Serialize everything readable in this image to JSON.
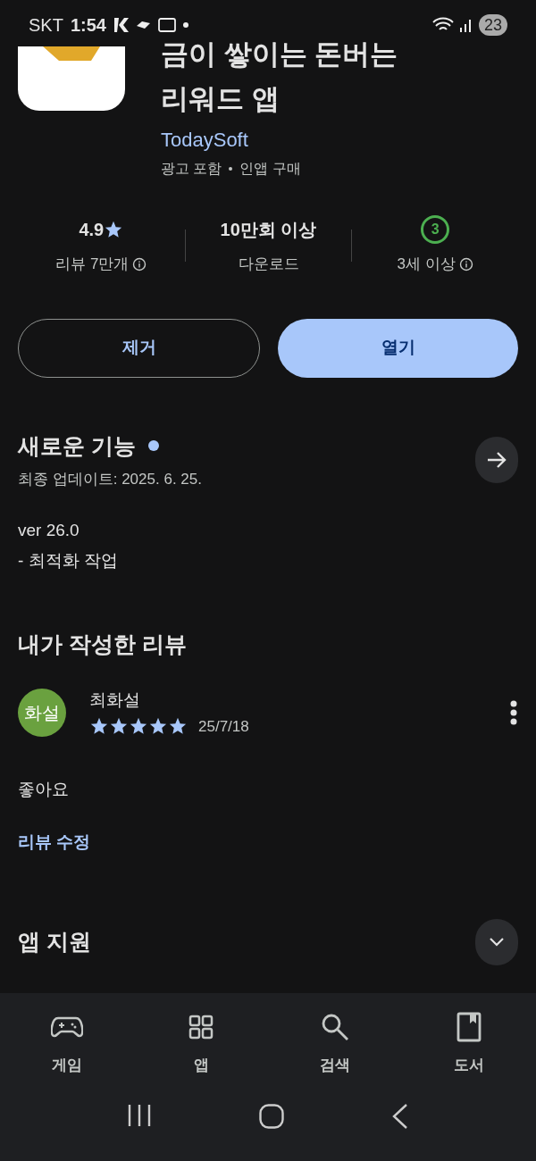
{
  "status_bar": {
    "carrier": "SKT",
    "time": "1:54",
    "notification_count": "23"
  },
  "app": {
    "title_lines": [
      "금이 쌓이는 돈버는",
      "리워드 앱"
    ],
    "developer": "TodaySoft",
    "tags": [
      "광고 포함",
      "인앱 구매"
    ]
  },
  "stats": [
    {
      "kind": "rating",
      "value": "4.9",
      "label": "리뷰 7만개"
    },
    {
      "kind": "text",
      "value": "10만회 이상",
      "label": "다운로드"
    },
    {
      "kind": "age",
      "value": "3",
      "label": "3세 이상"
    }
  ],
  "buttons": [
    {
      "label": "제거",
      "kind": "outline"
    },
    {
      "label": "열기",
      "kind": "filled"
    }
  ],
  "whats_new": {
    "title": "새로운 기능",
    "updated": "최종 업데이트: 2025. 6. 25.",
    "lines": [
      "ver 26.0",
      "- 최적화 작업"
    ]
  },
  "my_review": {
    "title": "내가 작성한 리뷰",
    "avatar": "화설",
    "name": "최화설",
    "stars": 5,
    "date": "25/7/18",
    "text": "좋아요",
    "edit_link": "리뷰 수정"
  },
  "app_support": {
    "title": "앱 지원",
    "expanded": false
  },
  "bottom_nav": [
    {
      "label": "게임"
    },
    {
      "label": "앱"
    },
    {
      "label": "검색"
    },
    {
      "label": "도서"
    }
  ]
}
